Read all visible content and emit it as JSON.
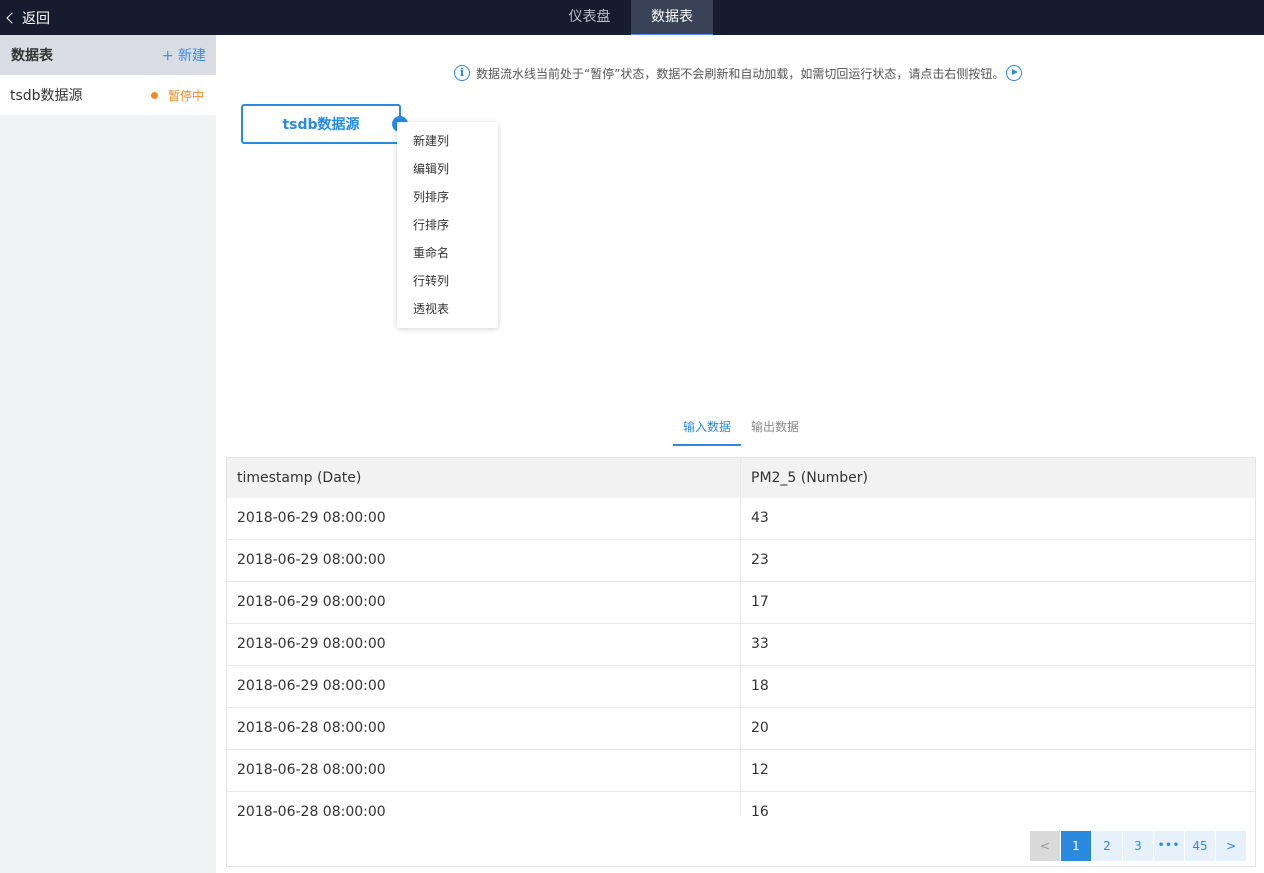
{
  "topbar": {
    "back_label": "返回",
    "tabs": [
      {
        "label": "仪表盘"
      },
      {
        "label": "数据表"
      }
    ]
  },
  "sidebar": {
    "title": "数据表",
    "new_label": "+ 新建",
    "items": [
      {
        "name": "tsdb数据源",
        "status": "暂停中"
      }
    ]
  },
  "notice": {
    "text": "数据流水线当前处于“暂停”状态，数据不会刷新和自动加载，如需切回运行状态，请点击右侧按钮。"
  },
  "pipeline": {
    "node_label": "tsdb数据源",
    "menu": [
      "新建列",
      "编辑列",
      "列排序",
      "行排序",
      "重命名",
      "行转列",
      "透视表"
    ]
  },
  "data_tabs": [
    {
      "label": "输入数据"
    },
    {
      "label": "输出数据"
    }
  ],
  "table": {
    "columns": [
      "timestamp (Date)",
      "PM2_5 (Number)"
    ],
    "rows": [
      [
        "2018-06-29 08:00:00",
        "43"
      ],
      [
        "2018-06-29 08:00:00",
        "23"
      ],
      [
        "2018-06-29 08:00:00",
        "17"
      ],
      [
        "2018-06-29 08:00:00",
        "33"
      ],
      [
        "2018-06-29 08:00:00",
        "18"
      ],
      [
        "2018-06-28 08:00:00",
        "20"
      ],
      [
        "2018-06-28 08:00:00",
        "12"
      ],
      [
        "2018-06-28 08:00:00",
        "16"
      ]
    ]
  },
  "pagination": {
    "prev": "<",
    "pages": [
      "1",
      "2",
      "3"
    ],
    "ellipsis": "•••",
    "last": "45",
    "next": ">",
    "current": 1
  },
  "colors": {
    "topbar_bg": "#161b2e",
    "accent": "#2b8ae0",
    "paused": "#f08a24"
  }
}
